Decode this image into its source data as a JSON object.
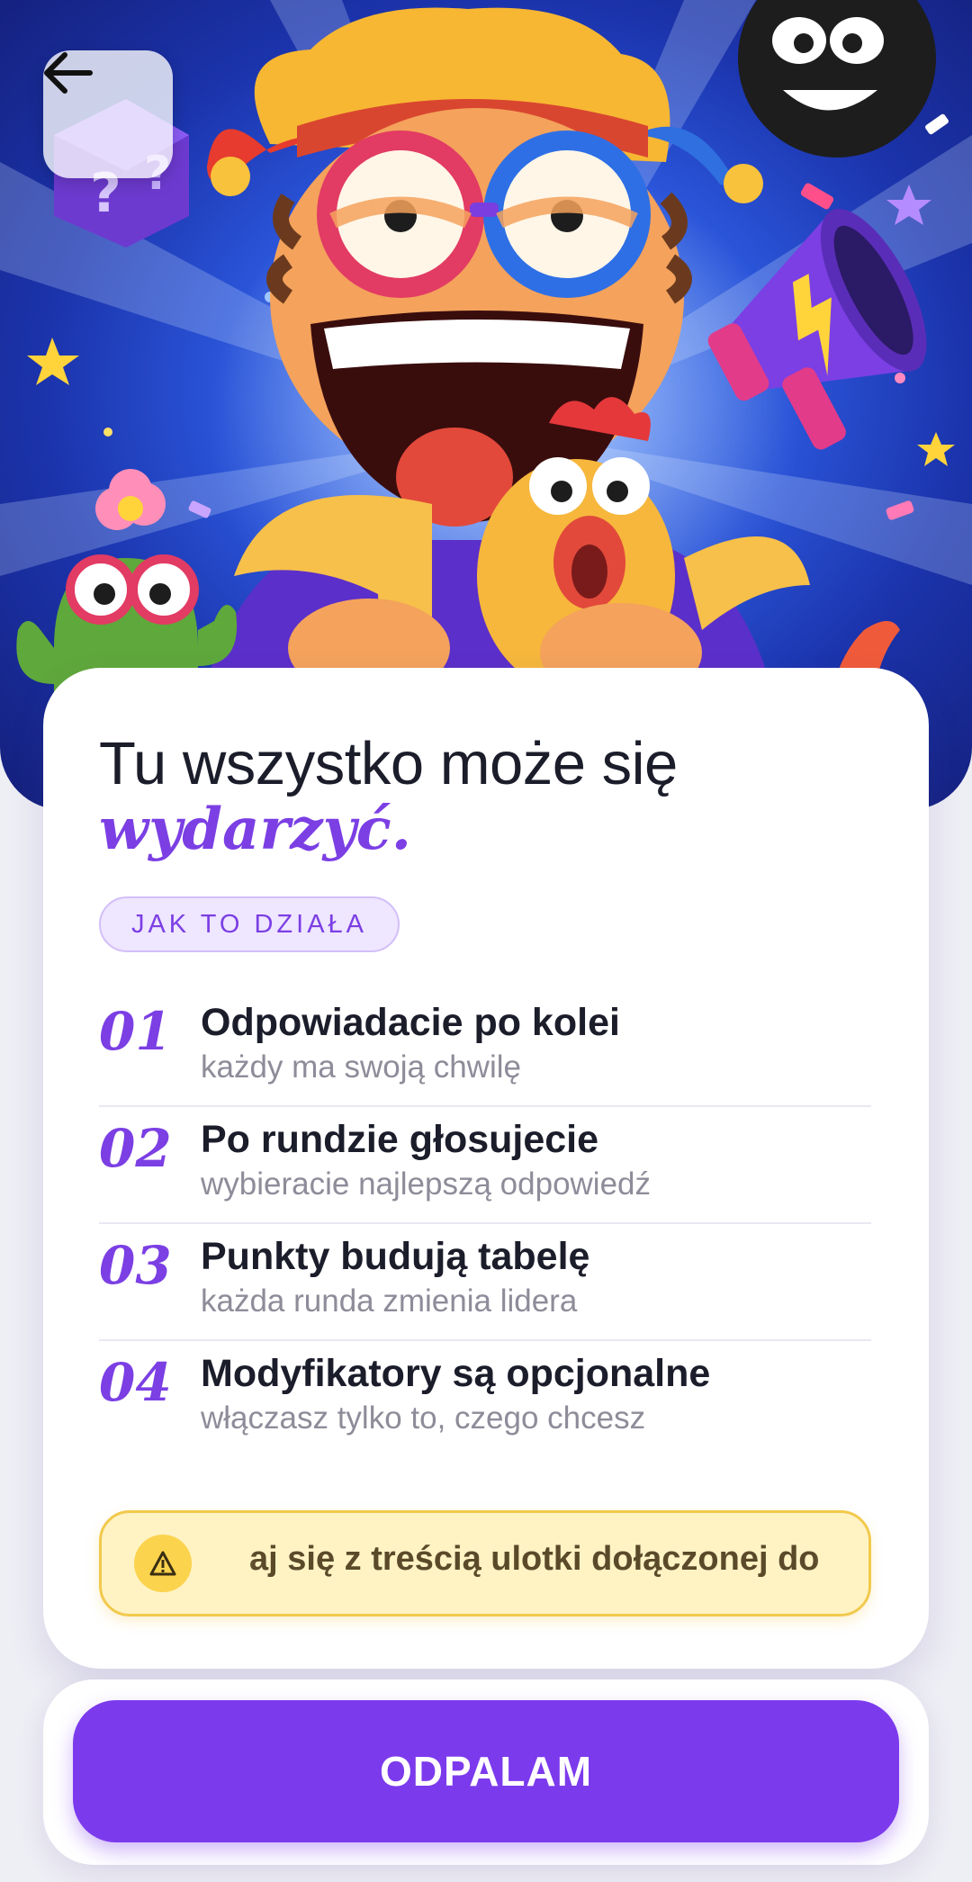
{
  "hero": {
    "back_icon": "arrow-left-icon",
    "illustration": "jester-party-illustration"
  },
  "headline": {
    "line1": "Tu wszystko może się",
    "line2": "wydarzyć."
  },
  "section_label": "JAK TO DZIAŁA",
  "steps": [
    {
      "num": "01",
      "title": "Odpowiadacie po kolei",
      "subtitle": "każdy ma swoją chwilę"
    },
    {
      "num": "02",
      "title": "Po rundzie głosujecie",
      "subtitle": "wybieracie najlepszą odpowiedź"
    },
    {
      "num": "03",
      "title": "Punkty budują tabelę",
      "subtitle": "każda runda zmienia lidera"
    },
    {
      "num": "04",
      "title": "Modyfikatory są opcjonalne",
      "subtitle": "włączasz tylko to, czego chcesz"
    }
  ],
  "notice": {
    "icon": "warning-icon",
    "text": "aj się z treścią ulotki dołączonej do"
  },
  "cta": {
    "label": "ODPALAM"
  },
  "colors": {
    "accent": "#7c3aed",
    "headline_accent": "#7b3fe4",
    "notice_bg": "#fff3c4",
    "notice_border": "#f2c94c"
  }
}
